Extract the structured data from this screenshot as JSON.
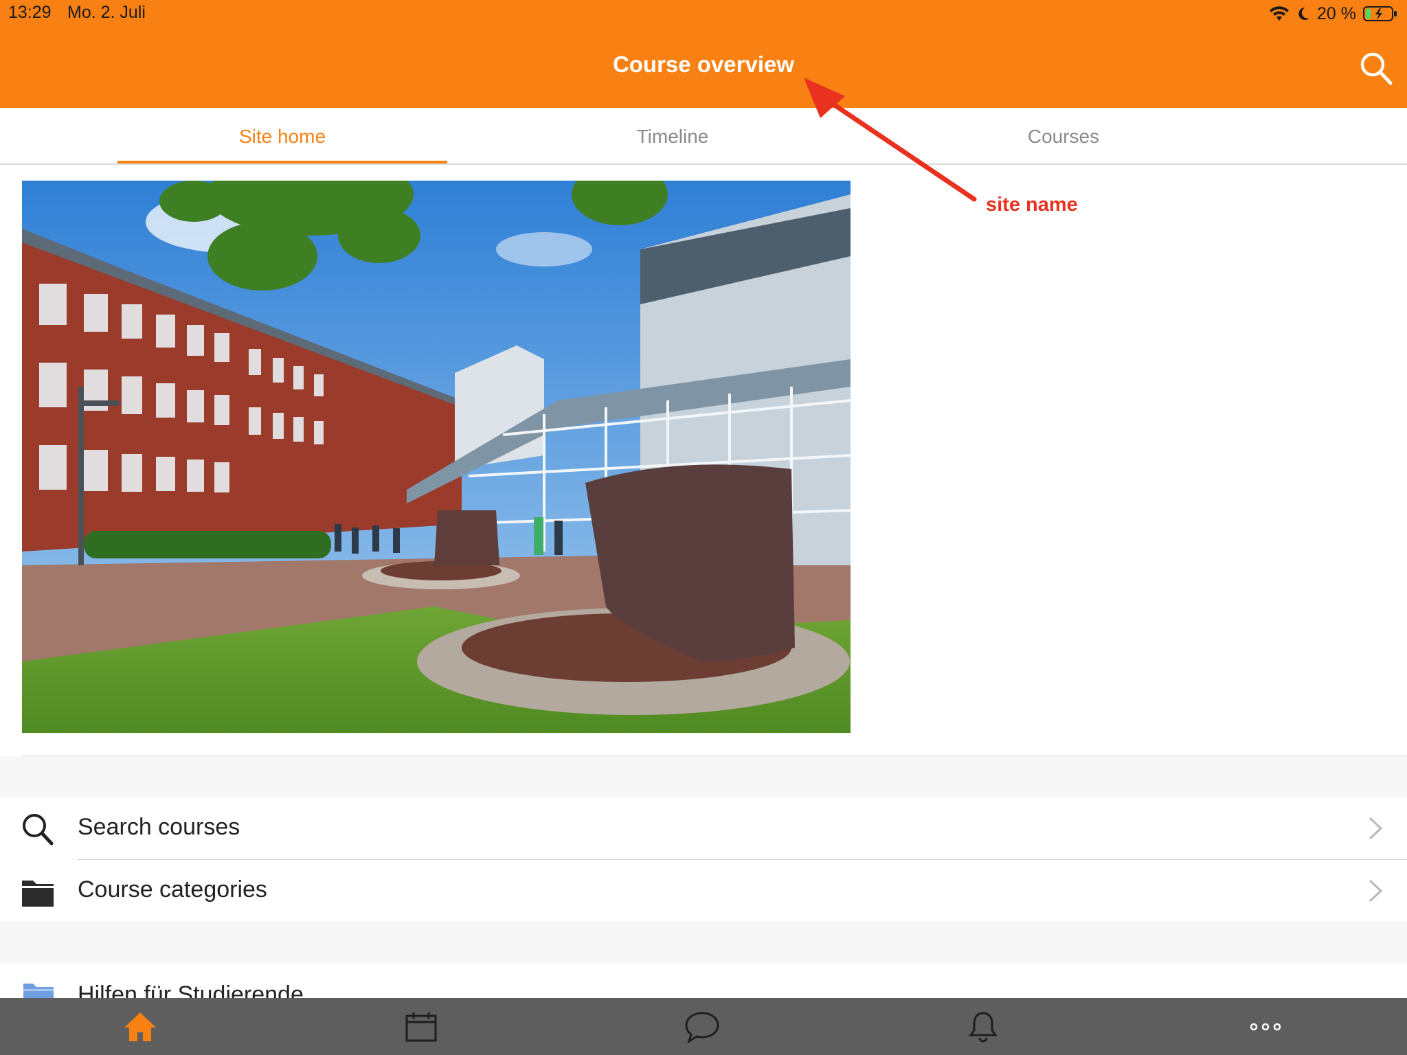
{
  "status_bar": {
    "time": "13:29",
    "date": "Mo. 2. Juli",
    "battery_percent": "20 %",
    "battery_level": 0.2,
    "icons": [
      "wifi-icon",
      "moon-icon",
      "battery-charging-icon"
    ]
  },
  "header": {
    "title": "Course overview",
    "background_color": "#f98012",
    "search_icon": "search-icon"
  },
  "tabs": [
    {
      "label": "Site home",
      "active": true
    },
    {
      "label": "Timeline",
      "active": false
    },
    {
      "label": "Courses",
      "active": false
    }
  ],
  "annotation": {
    "label": "site name",
    "color": "#e8321f"
  },
  "hero_image": {
    "subject": "campus-building-photo"
  },
  "list": {
    "search_courses": {
      "label": "Search courses",
      "icon": "search-icon"
    },
    "course_categories": {
      "label": "Course categories",
      "icon": "folder-icon"
    },
    "partial_item": {
      "label": "Hilfen für Studierende",
      "icon": "folder-icon"
    }
  },
  "bottom_nav": {
    "items": [
      {
        "icon": "home-icon",
        "active": true
      },
      {
        "icon": "calendar-icon",
        "active": false
      },
      {
        "icon": "chat-icon",
        "active": false
      },
      {
        "icon": "bell-icon",
        "active": false
      },
      {
        "icon": "more-icon",
        "active": false
      }
    ],
    "active_color": "#f98012"
  }
}
